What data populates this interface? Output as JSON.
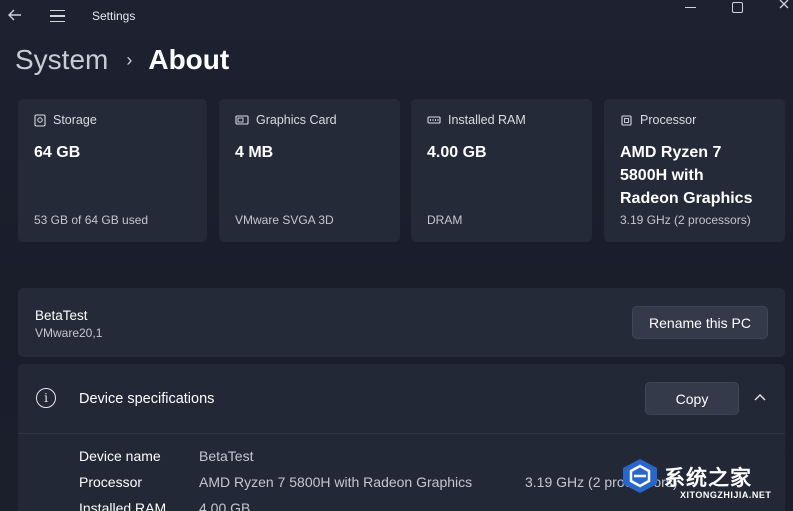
{
  "window": {
    "title": "Settings"
  },
  "breadcrumb": {
    "parent": "System",
    "separator": "›",
    "current": "About"
  },
  "cards": [
    {
      "icon": "storage-icon",
      "label": "Storage",
      "value": "64 GB",
      "sub": "53 GB of 64 GB used"
    },
    {
      "icon": "graphics-card-icon",
      "label": "Graphics Card",
      "value": "4 MB",
      "sub": "VMware SVGA 3D"
    },
    {
      "icon": "ram-icon",
      "label": "Installed RAM",
      "value": "4.00 GB",
      "sub": "DRAM"
    },
    {
      "icon": "processor-icon",
      "label": "Processor",
      "value_lines": [
        "AMD Ryzen 7",
        "5800H with",
        "Radeon Graphics"
      ],
      "sub": "3.19 GHz (2 processors)"
    }
  ],
  "pc": {
    "name": "BetaTest",
    "model": "VMware20,1",
    "rename_label": "Rename this PC"
  },
  "specs": {
    "title": "Device specifications",
    "copy_label": "Copy",
    "rows": [
      {
        "label": "Device name",
        "value": "BetaTest",
        "extra": ""
      },
      {
        "label": "Processor",
        "value": "AMD Ryzen 7 5800H with Radeon Graphics",
        "extra": "3.19 GHz  (2 processors)"
      },
      {
        "label": "Installed RAM",
        "value": "4.00 GB",
        "extra": ""
      }
    ]
  },
  "watermark": {
    "text": "系统之家",
    "sub": "XITONGZHIJIA.NET"
  },
  "colors": {
    "background": "#1c2030",
    "card": "#252a38",
    "button": "#343a49"
  }
}
